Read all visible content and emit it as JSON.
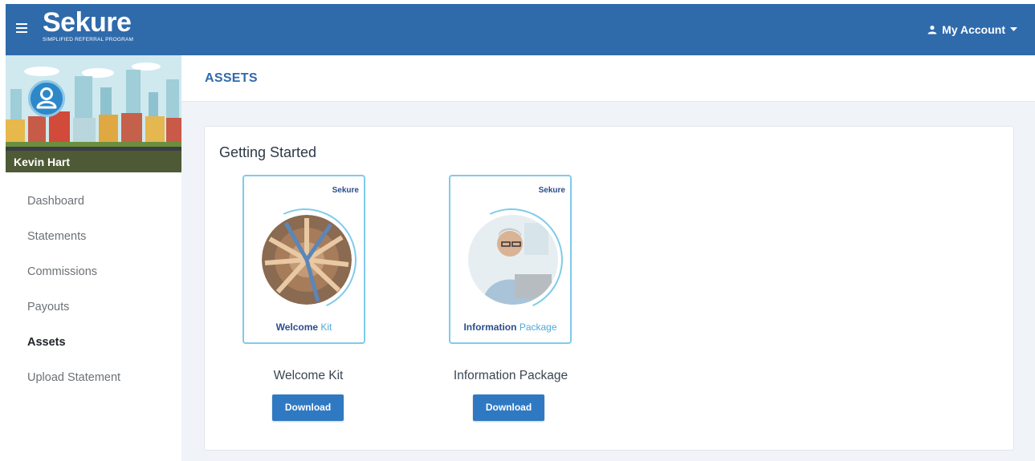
{
  "brand": {
    "name": "Sekure",
    "tagline": "SIMPLIFIED REFERRAL PROGRAM"
  },
  "header": {
    "account_label": "My Account"
  },
  "user": {
    "name": "Kevin Hart"
  },
  "sidebar": {
    "items": [
      {
        "label": "Dashboard",
        "active": false
      },
      {
        "label": "Statements",
        "active": false
      },
      {
        "label": "Commissions",
        "active": false
      },
      {
        "label": "Payouts",
        "active": false
      },
      {
        "label": "Assets",
        "active": true
      },
      {
        "label": "Upload Statement",
        "active": false
      }
    ]
  },
  "page": {
    "title": "ASSETS"
  },
  "section": {
    "title": "Getting Started",
    "assets": [
      {
        "thumb_logo": "Sekure",
        "thumb_bold": "Welcome",
        "thumb_light": "Kit",
        "name": "Welcome Kit",
        "button": "Download"
      },
      {
        "thumb_logo": "Sekure",
        "thumb_bold": "Information",
        "thumb_light": "Package",
        "name": "Information Package",
        "button": "Download"
      }
    ]
  },
  "colors": {
    "primary": "#2f6aab",
    "button": "#2f79c3",
    "accent": "#7fcbea"
  }
}
